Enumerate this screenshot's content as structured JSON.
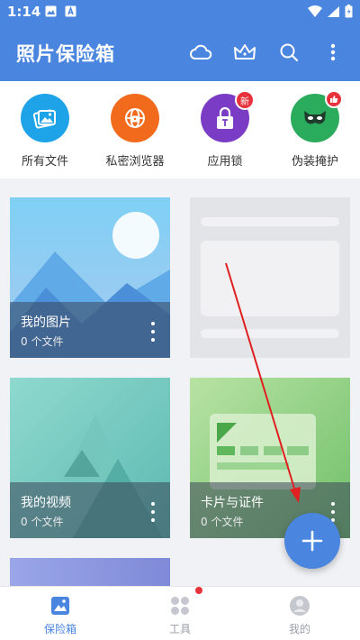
{
  "status_bar": {
    "time": "1:14"
  },
  "app_bar": {
    "title": "照片保险箱",
    "actions": [
      "cloud-icon",
      "crown-icon",
      "search-icon",
      "more-vert-icon"
    ]
  },
  "quick_actions": [
    {
      "label": "所有文件",
      "icon": "gallery-icon",
      "color": "#1fa3e8"
    },
    {
      "label": "私密浏览器",
      "icon": "globe-icon",
      "color": "#f26b1d",
      "badge": ""
    },
    {
      "label": "应用锁",
      "icon": "lock-icon",
      "color": "#7b3cc5",
      "badge": "新"
    },
    {
      "label": "伪装掩护",
      "icon": "mask-icon",
      "color": "#2bab5c"
    }
  ],
  "albums": [
    {
      "name": "我的图片",
      "count": "0 个文件"
    },
    {
      "name": "我的视频",
      "count": "0 个文件"
    },
    {
      "name": "卡片与证件",
      "count": "0 个文件"
    }
  ],
  "bottom_nav": [
    {
      "label": "保险箱",
      "active": true
    },
    {
      "label": "工具",
      "active": false
    },
    {
      "label": "我的",
      "active": false
    }
  ],
  "colors": {
    "primary": "#4a86e0",
    "badge_red": "#e8323b",
    "annotation_arrow": "#e02020"
  }
}
